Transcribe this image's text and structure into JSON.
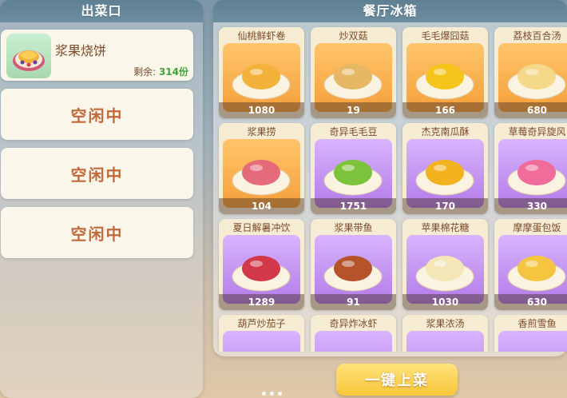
{
  "serving_window": {
    "title": "出菜口",
    "active_slot": {
      "dish": "浆果烧饼",
      "remaining_label": "剩余:",
      "remaining_value": "314份"
    },
    "idle_slots": [
      "空闲中",
      "空闲中",
      "空闲中"
    ]
  },
  "fridge": {
    "title": "餐厅冰箱",
    "items": [
      {
        "name": "仙桃鲜虾卷",
        "count": "1080",
        "tile": "orange",
        "icon": "shrimp-roll-dish-icon",
        "food_color": "#f2b23a"
      },
      {
        "name": "炒双菇",
        "count": "19",
        "tile": "orange",
        "icon": "mushroom-dish-icon",
        "food_color": "#e6b865"
      },
      {
        "name": "毛毛爆囧菇",
        "count": "166",
        "tile": "orange",
        "icon": "yellow-mushroom-dish-icon",
        "food_color": "#f5c51c"
      },
      {
        "name": "荔枝百合汤",
        "count": "680",
        "tile": "orange",
        "icon": "soup-bowl-icon",
        "food_color": "#f6d88a"
      },
      {
        "name": "浆果捞",
        "count": "104",
        "tile": "orange",
        "icon": "berry-dessert-icon",
        "food_color": "#e56a7a"
      },
      {
        "name": "奇异毛毛豆",
        "count": "1751",
        "tile": "purple",
        "icon": "green-bean-dish-icon",
        "food_color": "#7cc23a"
      },
      {
        "name": "杰克南瓜酥",
        "count": "170",
        "tile": "purple",
        "icon": "pumpkin-pastry-icon",
        "food_color": "#f2b21e"
      },
      {
        "name": "草莓奇异旋风",
        "count": "330",
        "tile": "purple",
        "icon": "strawberry-parfait-icon",
        "food_color": "#f06c9a"
      },
      {
        "name": "夏日解暑冲饮",
        "count": "1289",
        "tile": "purple",
        "icon": "summer-drink-icon",
        "food_color": "#d2374a"
      },
      {
        "name": "浆果带鱼",
        "count": "91",
        "tile": "purple",
        "icon": "fish-dish-icon",
        "food_color": "#b5542a"
      },
      {
        "name": "苹果棉花糖",
        "count": "1030",
        "tile": "purple",
        "icon": "marshmallow-dish-icon",
        "food_color": "#f5e6b8"
      },
      {
        "name": "摩摩蛋包饭",
        "count": "630",
        "tile": "purple",
        "icon": "omelette-rice-icon",
        "food_color": "#f5c542"
      },
      {
        "name": "葫芦炒茄子",
        "count": "",
        "tile": "purple",
        "icon": "eggplant-dish-icon",
        "food_color": "#8a4fa0"
      },
      {
        "name": "奇异炸冰虾",
        "count": "",
        "tile": "purple",
        "icon": "fried-shrimp-icon",
        "food_color": "#f2a23a"
      },
      {
        "name": "浆果浓汤",
        "count": "",
        "tile": "purple",
        "icon": "berry-soup-icon",
        "food_color": "#c84a6a"
      },
      {
        "name": "香煎雪鱼",
        "count": "",
        "tile": "purple",
        "icon": "cod-dish-icon",
        "food_color": "#f0d7a0"
      }
    ]
  },
  "actions": {
    "serve_all_label": "一键上菜"
  }
}
